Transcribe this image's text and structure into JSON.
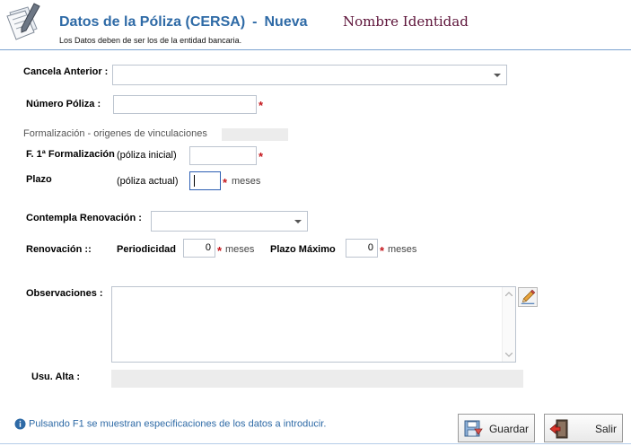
{
  "header": {
    "title_main": "Datos de la Póliza (CERSA)",
    "title_sep": "-",
    "title_mode": "Nueva",
    "identity": "Nombre Identidad",
    "subtitle": "Los Datos deben de ser los de la entidad bancaria."
  },
  "form": {
    "cancela_anterior": {
      "label": "Cancela Anterior :",
      "value": ""
    },
    "numero_poliza": {
      "label": "Número Póliza :",
      "value": "",
      "required": "*"
    },
    "formalizacion_section": {
      "label": "Formalización - origenes de vinculaciones",
      "value": ""
    },
    "f1_formalizacion": {
      "label": "F. 1ª Formalización",
      "hint": "(póliza inicial)",
      "value": "",
      "required": "*"
    },
    "plazo": {
      "label": "Plazo",
      "hint": "(póliza actual)",
      "value": "",
      "required": "*",
      "unit": "meses"
    },
    "contempla_renovacion": {
      "label": "Contempla Renovación :",
      "value": ""
    },
    "renovacion": {
      "label": "Renovación ::",
      "periodicidad_label": "Periodicidad",
      "periodicidad_value": "0",
      "periodicidad_required": "*",
      "periodicidad_unit": "meses",
      "plazo_maximo_label": "Plazo Máximo",
      "plazo_maximo_value": "0",
      "plazo_maximo_required": "*",
      "plazo_maximo_unit": "meses"
    },
    "observaciones": {
      "label": "Observaciones :",
      "value": ""
    },
    "usu_alta": {
      "label": "Usu. Alta  :",
      "value": ""
    }
  },
  "footer": {
    "info_text": "Pulsando F1 se muestran especificaciones de los datos a introducir.",
    "guardar_label": "Guardar",
    "salir_label": "Salir"
  },
  "icons": {
    "logo": "notepad-pencil-icon",
    "info": "info-icon",
    "edit": "pencil-icon",
    "save": "save-disk-icon",
    "exit": "exit-door-icon"
  },
  "colors": {
    "title": "#2e6aa6",
    "identity": "#5c1238",
    "required": "#c4161c",
    "info": "#2e6aa6"
  }
}
